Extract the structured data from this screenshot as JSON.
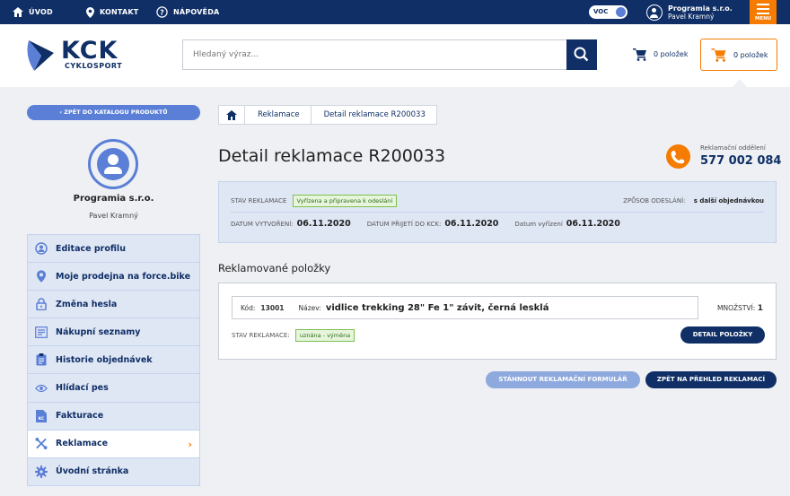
{
  "topbar": {
    "home_label": "ÚVOD",
    "contact_label": "KONTAKT",
    "help_label": "NÁPOVĚDA",
    "voc_label": "VOC",
    "user_company": "Programia s.r.o.",
    "user_name": "Pavel Kramný",
    "menu_label": "MENU"
  },
  "header": {
    "logo_text": "KCK",
    "logo_sub": "CYKLOSPORT",
    "search_placeholder": "Hledaný výraz...",
    "cart1_label": "0 položek",
    "cart2_label": "0 položek"
  },
  "sidebar": {
    "back_label": "ZPĚT DO KATALOGU PRODUKTŮ",
    "back_arrow": "‹",
    "company": "Programia s.r.o.",
    "person": "Pavel Kramný",
    "items": [
      {
        "label": "Editace profilu",
        "icon": "user-circle-icon"
      },
      {
        "label": "Moje prodejna na force.bike",
        "icon": "map-pin-icon"
      },
      {
        "label": "Změna hesla",
        "icon": "lock-icon"
      },
      {
        "label": "Nákupní seznamy",
        "icon": "list-icon"
      },
      {
        "label": "Historie objednávek",
        "icon": "clipboard-icon"
      },
      {
        "label": "Hlídací pes",
        "icon": "eye-icon"
      },
      {
        "label": "Fakturace",
        "icon": "invoice-icon"
      },
      {
        "label": "Reklamace",
        "icon": "tools-icon"
      },
      {
        "label": "Úvodní stránka",
        "icon": "gear-icon"
      }
    ],
    "active_chevron": "›"
  },
  "breadcrumb": {
    "items": [
      "Reklamace",
      "Detail reklamace R200033"
    ]
  },
  "main": {
    "title": "Detail reklamace R200033",
    "phone_label": "Reklamační oddělení",
    "phone_number": "577 002 084",
    "status_label": "STAV REKLAMACE",
    "status_value": "Vyřízena a připravena k odeslání",
    "shipping_label": "ZPŮSOB ODESLÁNÍ:",
    "shipping_value": "s další objednávkou",
    "created_label": "DATUM VYTVOŘENÍ:",
    "created_value": "06.11.2020",
    "received_label": "DATUM PŘIJETÍ DO KCK:",
    "received_value": "06.11.2020",
    "resolved_label": "Datum vyřízení",
    "resolved_value": "06.11.2020",
    "items_title": "Reklamované položky",
    "item": {
      "code_label": "Kód:",
      "code": "13001",
      "name_label": "Název:",
      "name": "vidlice trekking 28\" Fe 1\" závit, černá lesklá",
      "qty_label": "MNOŽSTVÍ:",
      "qty": "1",
      "status_label": "STAV REKLAMACE:",
      "status_value": "uznána - výměna",
      "detail_button": "DETAIL POLOŽKY"
    },
    "download_button": "STÁHNOUT REKLAMAČNÍ FORMULÁŘ",
    "back_button": "ZPĚT NA PŘEHLED REKLAMACÍ"
  },
  "colors": {
    "navy": "#0f2f66",
    "orange": "#f57c00",
    "blue": "#5b7fd6",
    "green_badge": "#7cc04f"
  }
}
